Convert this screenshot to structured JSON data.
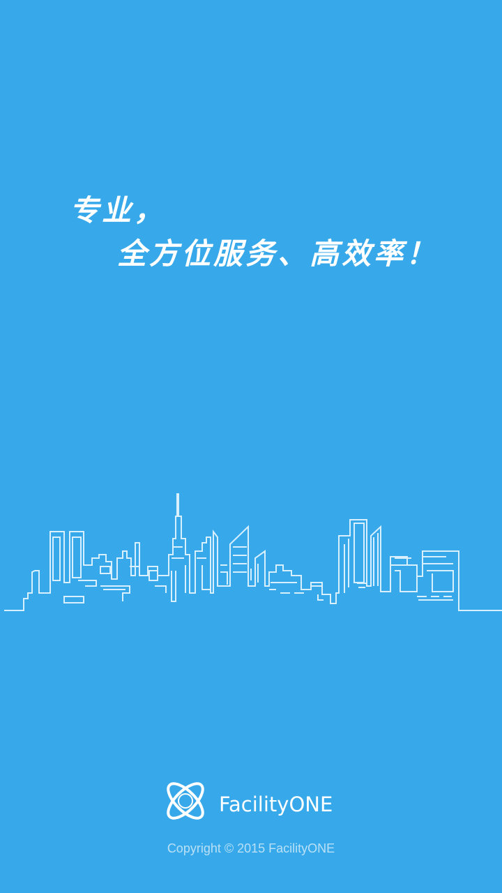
{
  "slogan": {
    "line1": "专业，",
    "line2": "全方位服务、高效率！"
  },
  "brand": {
    "name": "FacilityONE",
    "logo_icon": "atom-orbit-logo-icon"
  },
  "footer": {
    "copyright": "Copyright © 2015 FacilityONE"
  },
  "colors": {
    "background": "#37a9ea",
    "text": "#ffffff",
    "skyline_stroke": "#d8efff",
    "copyright_text": "#b9e0f7"
  }
}
